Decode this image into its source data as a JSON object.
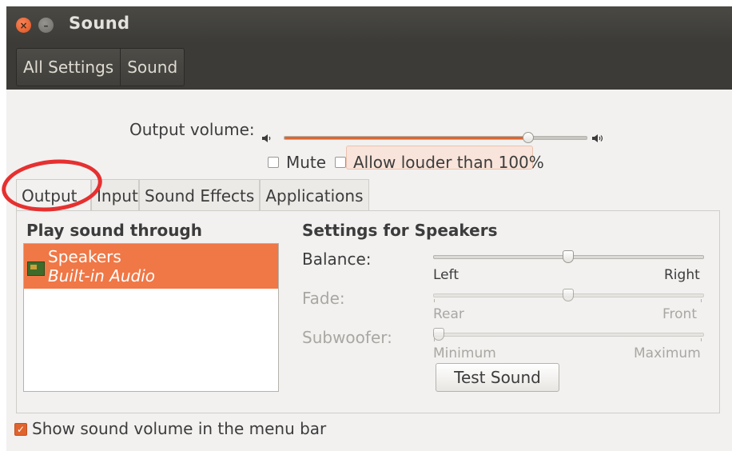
{
  "window": {
    "title": "Sound",
    "close_glyph": "×",
    "minimize_glyph": "–"
  },
  "breadcrumb": [
    "All Settings",
    "Sound"
  ],
  "output_volume": {
    "label": "Output volume:",
    "level_percent": 81,
    "low_icon": "speaker-low-icon",
    "high_icon": "speaker-high-icon",
    "mute_label": "Mute",
    "mute_checked": false,
    "louder_label": "Allow louder than 100%",
    "louder_checked": false
  },
  "tabs": [
    "Output",
    "Input",
    "Sound Effects",
    "Applications"
  ],
  "active_tab": "Output",
  "output": {
    "list_header": "Play sound through",
    "devices": [
      {
        "name": "Speakers",
        "description": "Built-in Audio",
        "selected": true
      }
    ],
    "settings_header": "Settings for Speakers",
    "balance": {
      "label": "Balance:",
      "left": "Left",
      "right": "Right",
      "position": 0.5
    },
    "fade": {
      "label": "Fade:",
      "left": "Rear",
      "right": "Front",
      "position": 0.5
    },
    "subwoofer": {
      "label": "Subwoofer:",
      "left": "Minimum",
      "right": "Maximum",
      "position": 0
    },
    "test_button": "Test Sound"
  },
  "footer": {
    "show_volume_label": "Show sound volume in the menu bar",
    "show_volume_checked": true
  },
  "colors": {
    "accent": "#e0642e",
    "selection": "#f07746",
    "annotation": "#e63030"
  }
}
